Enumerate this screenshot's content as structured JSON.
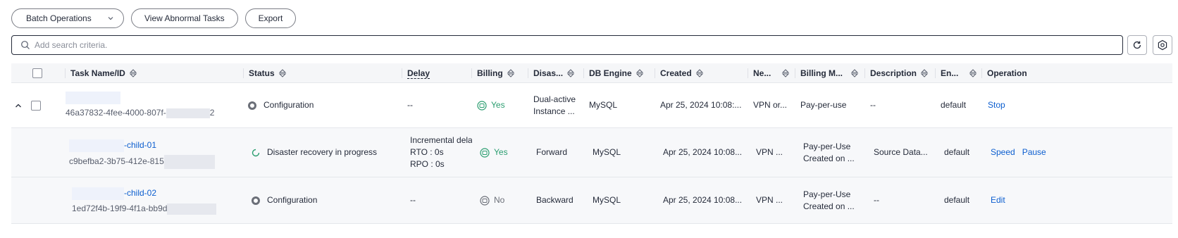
{
  "toolbar": {
    "batch_operations_label": "Batch Operations",
    "view_abnormal_label": "View Abnormal Tasks",
    "export_label": "Export"
  },
  "search": {
    "placeholder": "Add search criteria."
  },
  "table": {
    "headers": {
      "task_name": "Task Name/ID",
      "status": "Status",
      "delay": "Delay",
      "billing": "Billing",
      "disaster": "Disas...",
      "db_engine": "DB Engine",
      "created": "Created",
      "network": "Ne...",
      "billing_mode": "Billing M...",
      "description": "Description",
      "enterprise": "En...",
      "operation": "Operation"
    },
    "rows": [
      {
        "id": "46a37832-4fee-4000-807f-",
        "id_tail": "2",
        "status": "Configuration",
        "delay": "--",
        "billing": "Yes",
        "disaster_line1": "Dual-active",
        "disaster_line2": "Instance ...",
        "db_engine": "MySQL",
        "created": "Apr 25, 2024 10:08:...",
        "network": "VPN or...",
        "billing_mode": "Pay-per-use",
        "description": "--",
        "enterprise": "default",
        "op1": "Stop"
      },
      {
        "name_suffix": "-child-01",
        "id": "c9befba2-3b75-412e-815",
        "status": "Disaster recovery in progress",
        "delay_line1": "Incremental delay",
        "delay_line2": "RTO : 0s",
        "delay_line3": "RPO : 0s",
        "billing": "Yes",
        "disaster": "Forward",
        "db_engine": "MySQL",
        "created": "Apr 25, 2024 10:08...",
        "network": "VPN ...",
        "billing_mode_line1": "Pay-per-Use",
        "billing_mode_line2": "Created on ...",
        "description": "Source Data...",
        "enterprise": "default",
        "op1": "Speed",
        "op2": "Pause"
      },
      {
        "name_suffix": "-child-02",
        "id": "1ed72f4b-19f9-4f1a-bb9d",
        "status": "Configuration",
        "delay": "--",
        "billing": "No",
        "disaster": "Backward",
        "db_engine": "MySQL",
        "created": "Apr 25, 2024 10:08...",
        "network": "VPN ...",
        "billing_mode_line1": "Pay-per-Use",
        "billing_mode_line2": "Created on ...",
        "description": "--",
        "enterprise": "default",
        "op1": "Edit"
      }
    ]
  },
  "colors": {
    "link": "#0c5ecf",
    "billing_yes": "#2a9d6f",
    "header_bg": "#f5f6f8",
    "child_row_bg": "#f7f8fa"
  }
}
